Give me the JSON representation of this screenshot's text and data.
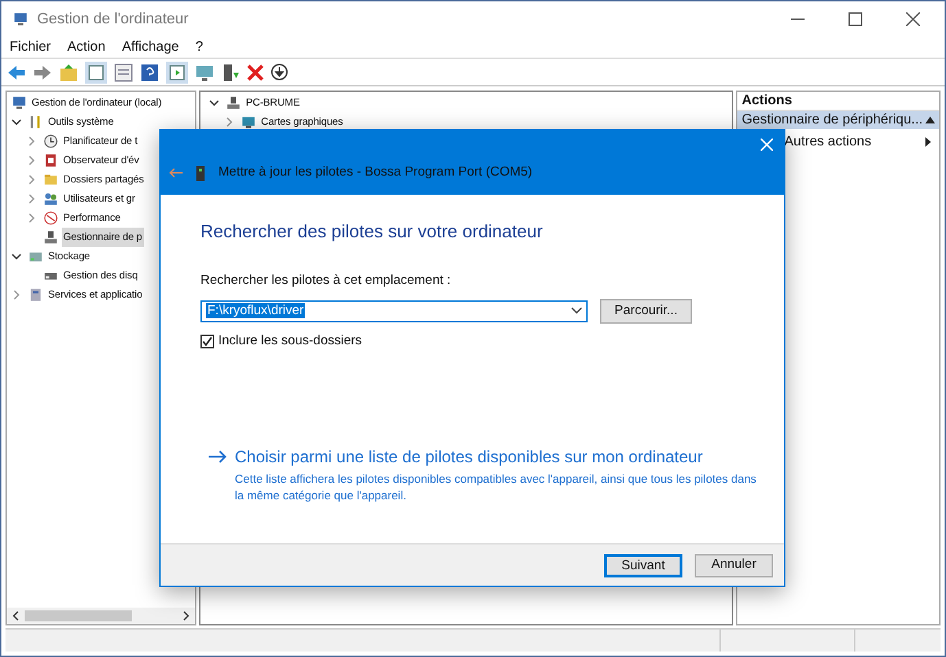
{
  "window": {
    "title": "Gestion de l'ordinateur"
  },
  "menu": [
    "Fichier",
    "Action",
    "Affichage",
    "?"
  ],
  "tree": [
    {
      "label": "Gestion de l'ordinateur (local)",
      "kind": "computer",
      "selected": false,
      "children": [
        {
          "label": "Outils système",
          "kind": "tools",
          "expanded": true,
          "selected": false,
          "children": [
            {
              "label": "Planificateur de t",
              "kind": "clock",
              "expanded": false,
              "selected": false
            },
            {
              "label": "Observateur d'év",
              "kind": "log",
              "expanded": false,
              "selected": false
            },
            {
              "label": "Dossiers partagés",
              "kind": "folder",
              "expanded": false,
              "selected": false
            },
            {
              "label": "Utilisateurs et gr",
              "kind": "users",
              "expanded": false,
              "selected": false
            },
            {
              "label": "Performance",
              "kind": "gauge",
              "expanded": false,
              "selected": false
            },
            {
              "label": "Gestionnaire de p",
              "kind": "device",
              "selected": true
            }
          ]
        },
        {
          "label": "Stockage",
          "kind": "storage",
          "expanded": true,
          "selected": false,
          "children": [
            {
              "label": "Gestion des disq",
              "kind": "disk",
              "selected": false
            }
          ]
        },
        {
          "label": "Services et applicatio",
          "kind": "services",
          "expanded": false,
          "selected": false
        }
      ]
    }
  ],
  "device_tree": [
    {
      "label": "PC-BRUME",
      "kind": "device",
      "expanded": true,
      "children": [
        {
          "label": "Cartes graphiques",
          "kind": "display",
          "expanded": false
        }
      ]
    }
  ],
  "actions": {
    "title": "Actions",
    "items": [
      {
        "label": "Gestionnaire de périphériqu...",
        "kind": "header"
      },
      {
        "label": "Autres actions",
        "kind": "submenu"
      }
    ]
  },
  "dialog": {
    "title": "Mettre à jour les pilotes - Bossa Program Port (COM5)",
    "heading": "Rechercher des pilotes sur votre ordinateur",
    "location_label": "Rechercher les pilotes à cet emplacement :",
    "location_value": "F:\\kryoflux\\driver",
    "browse_button": "Parcourir...",
    "include_subfolders": {
      "label": "Inclure les sous-dossiers",
      "checked": true
    },
    "link": {
      "title": "Choisir parmi une liste de pilotes disponibles sur mon ordinateur",
      "description": "Cette liste affichera les pilotes disponibles compatibles avec l'appareil, ainsi que tous les pilotes dans la même catégorie que l'appareil."
    },
    "buttons": [
      {
        "label": "Suivant",
        "kind": "default"
      },
      {
        "label": "Annuler",
        "kind": "normal"
      }
    ]
  }
}
